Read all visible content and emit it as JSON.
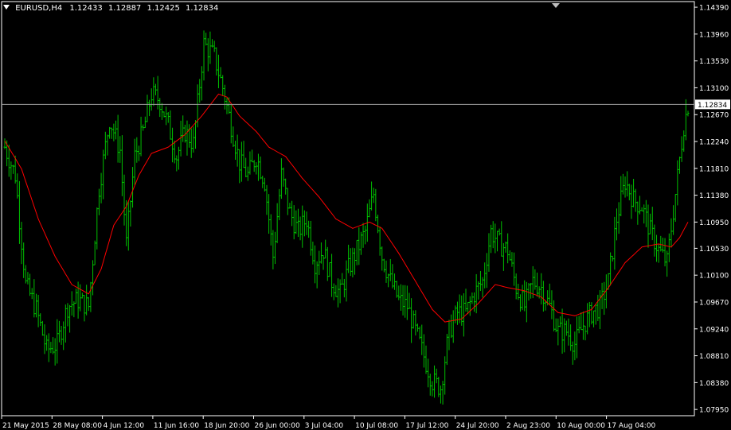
{
  "header": {
    "symbol": "EURUSD,H4",
    "open": "1.12433",
    "high": "1.12887",
    "low": "1.12425",
    "close": "1.12834"
  },
  "colors": {
    "background": "#000000",
    "bars": "#00c000",
    "moving_average": "#ff0000",
    "axis": "#ffffff",
    "price_line": "#a0a0a0",
    "price_label_bg": "#ffffff",
    "price_label_text": "#000000"
  },
  "chart_data": {
    "type": "bar",
    "subtype": "ohlc",
    "title": "EURUSD,H4",
    "current_price": "1.12834",
    "ylim": [
      1.0785,
      1.1448
    ],
    "y_ticks": [
      "1.14390",
      "1.13960",
      "1.13530",
      "1.13100",
      "1.12670",
      "1.12240",
      "1.11810",
      "1.11380",
      "1.10950",
      "1.10530",
      "1.10100",
      "1.09670",
      "1.09240",
      "1.08810",
      "1.08380",
      "1.07950"
    ],
    "x_ticks": [
      "21 May 2015",
      "28 May 08:00",
      "4 Jun 12:00",
      "11 Jun 16:00",
      "18 Jun 20:00",
      "26 Jun 00:00",
      "3 Jul 04:00",
      "10 Jul 08:00",
      "17 Jul 12:00",
      "24 Jul 20:00",
      "2 Aug 23:00",
      "10 Aug 00:00",
      "17 Aug 04:00"
    ],
    "close_series": [
      {
        "bar": 0,
        "close": 1.1215
      },
      {
        "bar": 5,
        "close": 1.117
      },
      {
        "bar": 10,
        "close": 1.0995
      },
      {
        "bar": 15,
        "close": 1.0955
      },
      {
        "bar": 20,
        "close": 1.089
      },
      {
        "bar": 25,
        "close": 1.09
      },
      {
        "bar": 30,
        "close": 1.096
      },
      {
        "bar": 35,
        "close": 1.097
      },
      {
        "bar": 40,
        "close": 1.096
      },
      {
        "bar": 45,
        "close": 1.115
      },
      {
        "bar": 50,
        "close": 1.126
      },
      {
        "bar": 55,
        "close": 1.121
      },
      {
        "bar": 58,
        "close": 1.106
      },
      {
        "bar": 62,
        "close": 1.12
      },
      {
        "bar": 66,
        "close": 1.124
      },
      {
        "bar": 70,
        "close": 1.13
      },
      {
        "bar": 74,
        "close": 1.129
      },
      {
        "bar": 78,
        "close": 1.125
      },
      {
        "bar": 82,
        "close": 1.12
      },
      {
        "bar": 86,
        "close": 1.124
      },
      {
        "bar": 90,
        "close": 1.122
      },
      {
        "bar": 95,
        "close": 1.138
      },
      {
        "bar": 100,
        "close": 1.136
      },
      {
        "bar": 104,
        "close": 1.131
      },
      {
        "bar": 108,
        "close": 1.125
      },
      {
        "bar": 112,
        "close": 1.119
      },
      {
        "bar": 116,
        "close": 1.117
      },
      {
        "bar": 120,
        "close": 1.12
      },
      {
        "bar": 124,
        "close": 1.116
      },
      {
        "bar": 128,
        "close": 1.104
      },
      {
        "bar": 132,
        "close": 1.117
      },
      {
        "bar": 136,
        "close": 1.111
      },
      {
        "bar": 140,
        "close": 1.108
      },
      {
        "bar": 144,
        "close": 1.11
      },
      {
        "bar": 148,
        "close": 1.103
      },
      {
        "bar": 152,
        "close": 1.105
      },
      {
        "bar": 156,
        "close": 1.1
      },
      {
        "bar": 160,
        "close": 1.098
      },
      {
        "bar": 164,
        "close": 1.102
      },
      {
        "bar": 168,
        "close": 1.105
      },
      {
        "bar": 172,
        "close": 1.108
      },
      {
        "bar": 176,
        "close": 1.114
      },
      {
        "bar": 180,
        "close": 1.104
      },
      {
        "bar": 184,
        "close": 1.1
      },
      {
        "bar": 188,
        "close": 1.097
      },
      {
        "bar": 192,
        "close": 1.096
      },
      {
        "bar": 196,
        "close": 1.092
      },
      {
        "bar": 200,
        "close": 1.088
      },
      {
        "bar": 204,
        "close": 1.084
      },
      {
        "bar": 208,
        "close": 1.083
      },
      {
        "bar": 212,
        "close": 1.092
      },
      {
        "bar": 216,
        "close": 1.095
      },
      {
        "bar": 220,
        "close": 1.095
      },
      {
        "bar": 224,
        "close": 1.098
      },
      {
        "bar": 228,
        "close": 1.1
      },
      {
        "bar": 232,
        "close": 1.108
      },
      {
        "bar": 236,
        "close": 1.106
      },
      {
        "bar": 240,
        "close": 1.105
      },
      {
        "bar": 244,
        "close": 1.099
      },
      {
        "bar": 248,
        "close": 1.096
      },
      {
        "bar": 252,
        "close": 1.1
      },
      {
        "bar": 256,
        "close": 1.099
      },
      {
        "bar": 260,
        "close": 1.096
      },
      {
        "bar": 264,
        "close": 1.092
      },
      {
        "bar": 268,
        "close": 1.092
      },
      {
        "bar": 272,
        "close": 1.09
      },
      {
        "bar": 276,
        "close": 1.093
      },
      {
        "bar": 280,
        "close": 1.095
      },
      {
        "bar": 284,
        "close": 1.096
      },
      {
        "bar": 288,
        "close": 1.1
      },
      {
        "bar": 292,
        "close": 1.11
      },
      {
        "bar": 296,
        "close": 1.116
      },
      {
        "bar": 300,
        "close": 1.113
      },
      {
        "bar": 304,
        "close": 1.112
      },
      {
        "bar": 308,
        "close": 1.108
      },
      {
        "bar": 312,
        "close": 1.105
      },
      {
        "bar": 316,
        "close": 1.103
      },
      {
        "bar": 320,
        "close": 1.114
      },
      {
        "bar": 324,
        "close": 1.125
      },
      {
        "bar": 326,
        "close": 1.1283
      }
    ],
    "bar_count": 327,
    "ma_series": [
      {
        "bar": 0,
        "ma": 1.1225
      },
      {
        "bar": 8,
        "ma": 1.118
      },
      {
        "bar": 16,
        "ma": 1.11
      },
      {
        "bar": 24,
        "ma": 1.104
      },
      {
        "bar": 32,
        "ma": 1.0995
      },
      {
        "bar": 40,
        "ma": 1.098
      },
      {
        "bar": 46,
        "ma": 1.102
      },
      {
        "bar": 52,
        "ma": 1.109
      },
      {
        "bar": 58,
        "ma": 1.112
      },
      {
        "bar": 64,
        "ma": 1.117
      },
      {
        "bar": 70,
        "ma": 1.1205
      },
      {
        "bar": 78,
        "ma": 1.1215
      },
      {
        "bar": 86,
        "ma": 1.1235
      },
      {
        "bar": 94,
        "ma": 1.1265
      },
      {
        "bar": 102,
        "ma": 1.13
      },
      {
        "bar": 106,
        "ma": 1.1295
      },
      {
        "bar": 112,
        "ma": 1.1265
      },
      {
        "bar": 120,
        "ma": 1.124
      },
      {
        "bar": 126,
        "ma": 1.1215
      },
      {
        "bar": 134,
        "ma": 1.12
      },
      {
        "bar": 142,
        "ma": 1.1165
      },
      {
        "bar": 150,
        "ma": 1.1135
      },
      {
        "bar": 158,
        "ma": 1.11
      },
      {
        "bar": 166,
        "ma": 1.1085
      },
      {
        "bar": 174,
        "ma": 1.1095
      },
      {
        "bar": 180,
        "ma": 1.1085
      },
      {
        "bar": 188,
        "ma": 1.1045
      },
      {
        "bar": 196,
        "ma": 1.1
      },
      {
        "bar": 204,
        "ma": 1.0955
      },
      {
        "bar": 210,
        "ma": 1.0935
      },
      {
        "bar": 218,
        "ma": 1.094
      },
      {
        "bar": 226,
        "ma": 1.0965
      },
      {
        "bar": 234,
        "ma": 1.0995
      },
      {
        "bar": 240,
        "ma": 1.099
      },
      {
        "bar": 248,
        "ma": 1.0985
      },
      {
        "bar": 256,
        "ma": 1.0975
      },
      {
        "bar": 264,
        "ma": 1.095
      },
      {
        "bar": 272,
        "ma": 1.0945
      },
      {
        "bar": 280,
        "ma": 1.0955
      },
      {
        "bar": 288,
        "ma": 1.099
      },
      {
        "bar": 296,
        "ma": 1.103
      },
      {
        "bar": 304,
        "ma": 1.1055
      },
      {
        "bar": 312,
        "ma": 1.106
      },
      {
        "bar": 318,
        "ma": 1.1055
      },
      {
        "bar": 322,
        "ma": 1.107
      },
      {
        "bar": 326,
        "ma": 1.1095
      }
    ],
    "grid": false
  }
}
